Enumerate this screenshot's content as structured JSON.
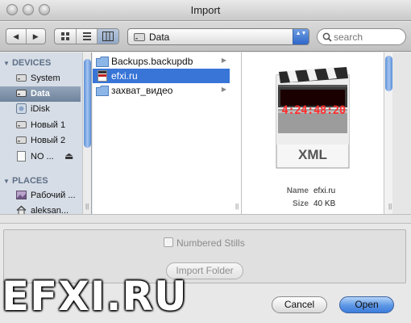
{
  "window": {
    "title": "Import"
  },
  "toolbar": {
    "back_glyph": "◀",
    "forward_glyph": "▶",
    "location": "Data",
    "popup_arrows": "▲▼",
    "search_placeholder": "search"
  },
  "sidebar": {
    "devices_header": "DEVICES",
    "places_header": "PLACES",
    "devices": [
      {
        "label": "System",
        "icon": "hard-drive-icon"
      },
      {
        "label": "Data",
        "icon": "hard-drive-icon",
        "selected": true
      },
      {
        "label": "iDisk",
        "icon": "idisk-icon"
      },
      {
        "label": "Новый 1",
        "icon": "hard-drive-icon"
      },
      {
        "label": "Новый 2",
        "icon": "hard-drive-icon"
      },
      {
        "label": "NO ...",
        "icon": "disk-icon",
        "eject": "⏏"
      }
    ],
    "places": [
      {
        "label": "Рабочий ...",
        "icon": "desktop-icon"
      },
      {
        "label": "aleksan...",
        "icon": "home-icon"
      }
    ]
  },
  "files": [
    {
      "name": "Backups.backupdb",
      "icon": "folder-icon",
      "has_children": true
    },
    {
      "name": "efxi.ru",
      "icon": "xml-file-icon",
      "selected": true
    },
    {
      "name": "захват_видео",
      "icon": "folder-icon",
      "has_children": true
    }
  ],
  "preview": {
    "timecode": "4:24:48:20",
    "badge": "XML",
    "name_label": "Name",
    "name_value": "efxi.ru",
    "size_label": "Size",
    "size_value": "40 KB"
  },
  "options": {
    "numbered_stills_label": "Numbered Stills",
    "numbered_stills_checked": false,
    "import_folder_label": "Import Folder"
  },
  "buttons": {
    "cancel": "Cancel",
    "open": "Open"
  },
  "watermark": "EFXI.RU",
  "colors": {
    "selection": "#3875d7",
    "sidebar_bg": "#d6dde6",
    "scroll_thumb": "#5a8fd8"
  }
}
